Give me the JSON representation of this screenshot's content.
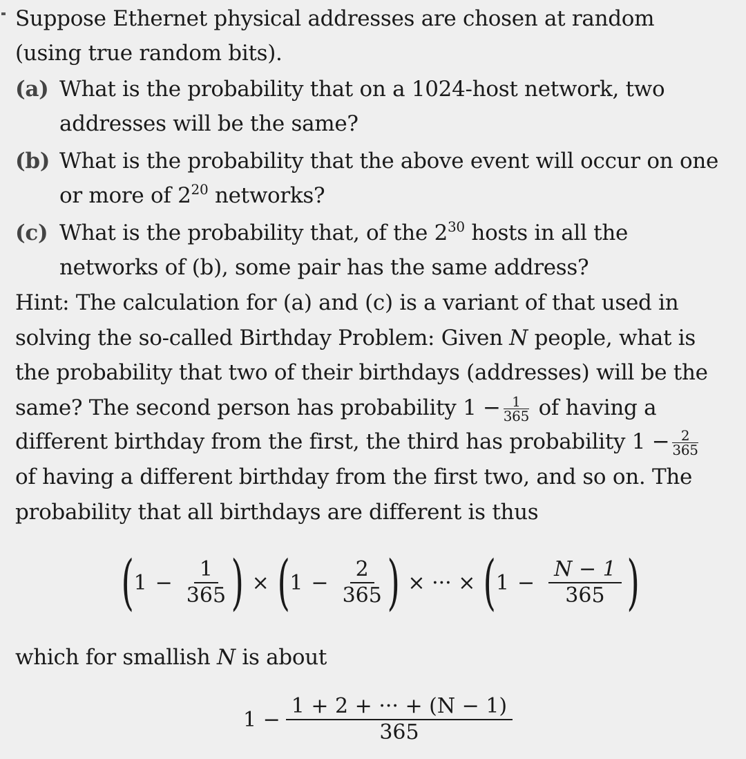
{
  "problem": {
    "intro": [
      "Suppose Ethernet physical addresses are chosen at random",
      "(using true random bits)."
    ],
    "parts": [
      {
        "label": "(a)",
        "line1": "What is the probability that on a 1024-host network, two",
        "line2": "addresses will be the same?"
      },
      {
        "label": "(b)",
        "line1": "What is the probability that the above event will occur on one",
        "line2_pre": "or more of 2",
        "line2_sup": "20",
        "line2_post": " networks?"
      },
      {
        "label": "(c)",
        "line1_pre": "What is the probability that, of the 2",
        "line1_sup": "30",
        "line1_post": " hosts in all the",
        "line2": "networks of (b), some pair has the same address?"
      }
    ],
    "hint": {
      "l1": "Hint: The calculation for (a) and (c) is a variant of that used in",
      "l2_pre": "solving the so-called Birthday Problem: Given ",
      "l2_var": "N",
      "l2_post": " people, what is",
      "l3": "the probability that two of their birthdays (addresses) will be the",
      "l4_pre": "same? The second person has probability 1 −",
      "l4_num": "1",
      "l4_den": "365",
      "l4_post": " of having a",
      "l5_pre": "different birthday from the first, the third has probability 1 −",
      "l5_num": "2",
      "l5_den": "365",
      "l6": "of having a different birthday from the first two, and so on. The",
      "l7": "probability that all birthdays are different is thus"
    },
    "eq1": {
      "one": "1",
      "minus": "−",
      "times": "×",
      "dots_times": "× ··· ×",
      "f1_num": "1",
      "f2_num": "2",
      "f3_num": "N − 1",
      "den": "365"
    },
    "mid_pre": "which for smallish ",
    "mid_var": "N",
    "mid_post": " is about",
    "eq2": {
      "lhs": "1 −",
      "num": "1 + 2 + ··· + (N − 1)",
      "den": "365"
    }
  }
}
